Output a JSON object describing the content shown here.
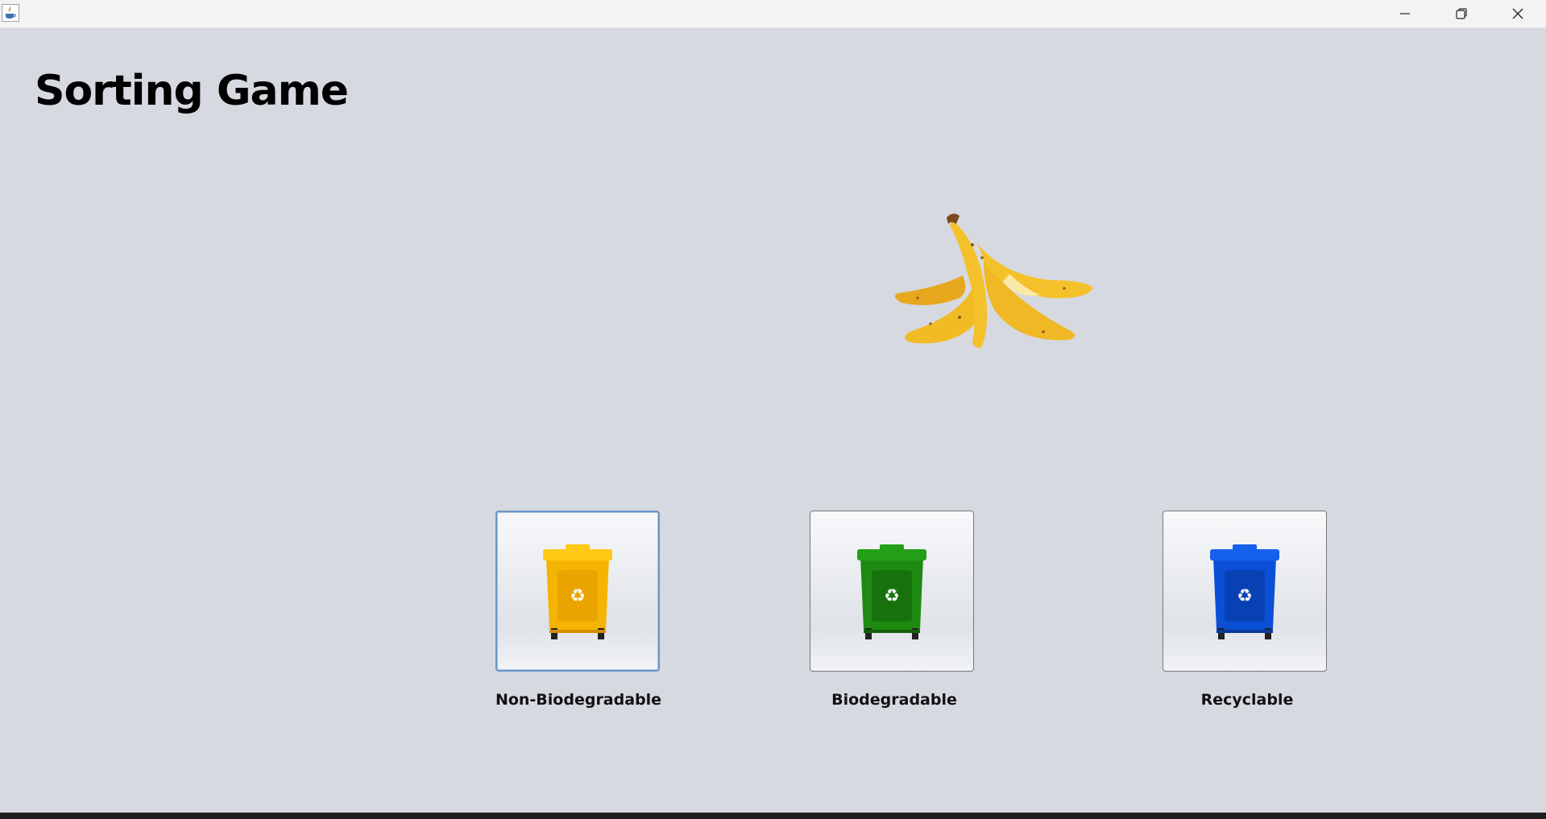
{
  "window": {
    "title": "",
    "controls": [
      "minimize-icon",
      "restore-icon",
      "close-icon"
    ]
  },
  "game": {
    "title": "Sorting Game",
    "current_item": "banana-peel"
  },
  "bins": [
    {
      "label": "Non-Biodegradable",
      "icon": "trash-bin-icon",
      "color": "#f5b400",
      "focused": true
    },
    {
      "label": "Biodegradable",
      "icon": "trash-bin-icon",
      "color": "#1e8a12",
      "focused": false
    },
    {
      "label": "Recyclable",
      "icon": "trash-bin-icon",
      "color": "#0a4fd6",
      "focused": false
    }
  ]
}
